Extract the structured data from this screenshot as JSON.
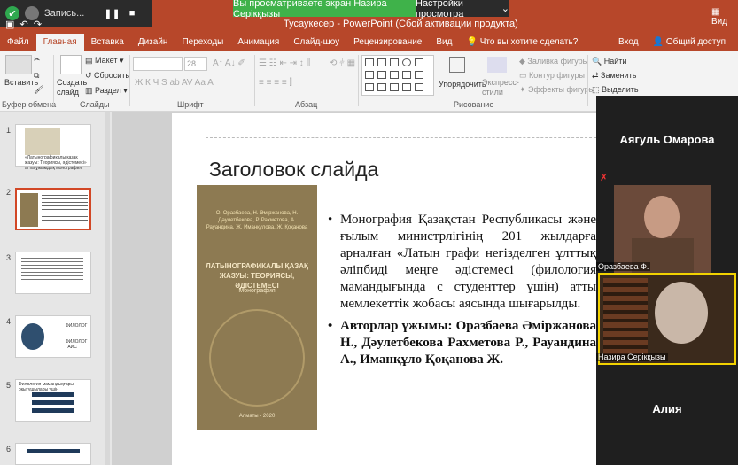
{
  "recording": {
    "label": "Запись..."
  },
  "share_bar": {
    "message": "Вы просматриваете экран Назира Серікқызы",
    "options": "Настройки просмотра"
  },
  "window": {
    "title": "Тусаукесер - PowerPoint (Сбой активации продукта)",
    "video_label": "Вид"
  },
  "tabs": [
    "Файл",
    "Главная",
    "Вставка",
    "Дизайн",
    "Переходы",
    "Анимация",
    "Слайд-шоу",
    "Рецензирование",
    "Вид",
    "Что вы хотите сделать?",
    "Вход",
    "Общий доступ"
  ],
  "ribbon": {
    "paste": "Вставить",
    "clipboard": "Буфер обмена",
    "create_slide": "Создать слайд",
    "slides": "Слайды",
    "layout": "Макет",
    "reset": "Сбросить",
    "section": "Раздел",
    "font": "Шрифт",
    "font_size": "28",
    "paragraph": "Абзац",
    "arrange": "Упорядочить",
    "quick_styles": "Экспресс-стили",
    "drawing": "Рисование",
    "fill": "Заливка фигуры",
    "outline": "Контур фигуры",
    "effects": "Эффекты фигуры",
    "find": "Найти",
    "replace": "Заменить",
    "select": "Выделить"
  },
  "thumbnails": {
    "numbers": [
      "1",
      "2",
      "3",
      "4",
      "5",
      "6"
    ],
    "t1": "«Латынографикалы қазақ жазуы: Теориясы, әдістемесі» атты ұжымдық монография",
    "t4a": "ФИЛОЛОГ",
    "t4b": "ФИЛОЛОГ ГАИС",
    "t5": "Филология мамандықтары оқытушылары үшін"
  },
  "slide": {
    "title": "Заголовок слайда",
    "book_authors": "О. Оразбаева, Н. Әміржанова, Н. Дәулетбекова, Р. Рахметова, А. Рауандина, Ж. Иманқұлова, Ж. Қоқанова",
    "book_title": "ЛАТЫНОГРАФИКАЛЫ ҚАЗАҚ ЖАЗУЫ: ТЕОРИЯСЫ, ӘДІСТЕМЕСІ",
    "book_subtitle": "Монография",
    "book_year": "Алматы - 2020",
    "bullet1": "Монография Қазақстан Республикасы және ғылым министрлігінің 201 жылдарға арналған «Латын графи негізделген ұлттық әліпбиді меңге әдістемесі (филология мамандығында с студенттер үшін) атты мемлекеттік жобасы аясында шығарылды.",
    "bullet2": "Авторлар ұжымы: Оразбаева Әміржанова Н., Дәулетбекова Рахметова Р., Рауандина А., Иманқұло Қоқанова Ж."
  },
  "participants": {
    "p1": "Аягуль Омарова",
    "p2_label": "Оразбаева Ф.",
    "p3_label": "Назира Серікқызы",
    "p4": "Алия"
  },
  "colors": {
    "accent": "#b7472a",
    "share_green": "#3fb24a"
  }
}
